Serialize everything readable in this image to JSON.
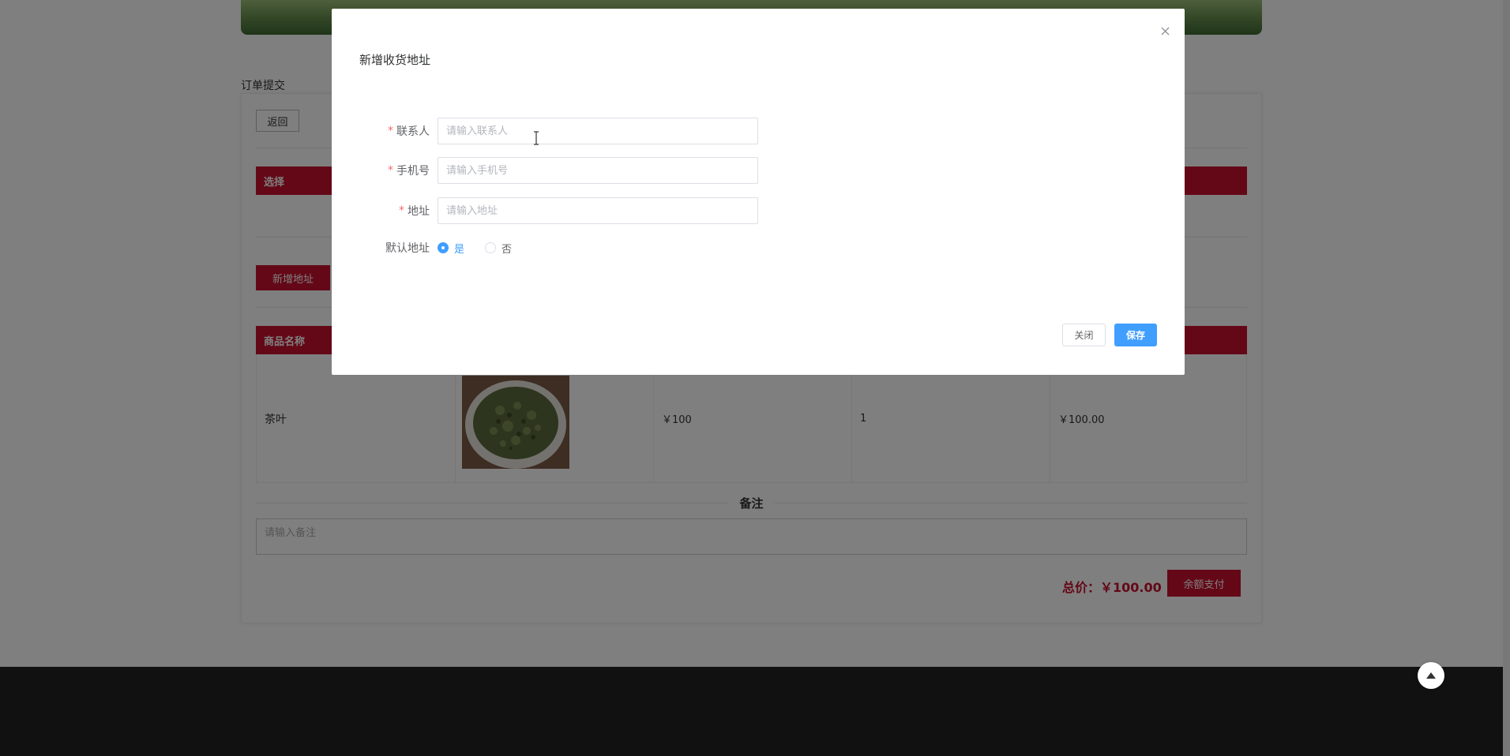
{
  "page": {
    "title": "订单提交",
    "back_label": "返回",
    "address_header": "选择",
    "add_address_label": "新增地址",
    "product_header": "商品名称",
    "product": {
      "name": "茶叶",
      "price": "￥100",
      "quantity": "1",
      "subtotal": "￥100.00"
    },
    "remark_title": "备注",
    "remark_placeholder": "请输入备注",
    "total_label": "总价：￥100.00",
    "pay_label": "余额支付"
  },
  "modal": {
    "title": "新增收货地址",
    "close_icon": "close-icon",
    "fields": {
      "contact": {
        "label": "联系人",
        "placeholder": "请输入联系人",
        "value": ""
      },
      "phone": {
        "label": "手机号",
        "placeholder": "请输入手机号",
        "value": ""
      },
      "address": {
        "label": "地址",
        "placeholder": "请输入地址",
        "value": ""
      }
    },
    "default_address": {
      "label": "默认地址",
      "options": [
        "是",
        "否"
      ],
      "selected": "是"
    },
    "close_label": "关闭",
    "save_label": "保存"
  },
  "colors": {
    "brand_red": "#c8102e",
    "primary_blue": "#409eff",
    "required": "#f56c6c"
  }
}
